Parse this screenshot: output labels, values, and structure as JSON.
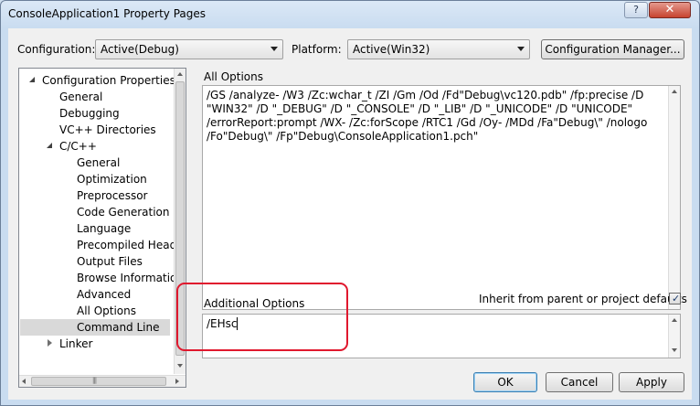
{
  "window": {
    "title": "ConsoleApplication1 Property Pages",
    "help": "?",
    "close": "✕"
  },
  "toolbar": {
    "configuration_label": "Configuration:",
    "configuration_value": "Active(Debug)",
    "platform_label": "Platform:",
    "platform_value": "Active(Win32)",
    "config_manager": "Configuration Manager..."
  },
  "tree": {
    "items": [
      {
        "label": "Configuration Properties"
      },
      {
        "label": "General"
      },
      {
        "label": "Debugging"
      },
      {
        "label": "VC++ Directories"
      },
      {
        "label": "C/C++"
      },
      {
        "label": "General"
      },
      {
        "label": "Optimization"
      },
      {
        "label": "Preprocessor"
      },
      {
        "label": "Code Generation"
      },
      {
        "label": "Language"
      },
      {
        "label": "Precompiled Heade"
      },
      {
        "label": "Output Files"
      },
      {
        "label": "Browse Information"
      },
      {
        "label": "Advanced"
      },
      {
        "label": "All Options"
      },
      {
        "label": "Command Line",
        "selected": true
      },
      {
        "label": "Linker"
      }
    ]
  },
  "all_options": {
    "label": "All Options",
    "text": "/GS /analyze- /W3 /Zc:wchar_t /ZI /Gm /Od /Fd\"Debug\\vc120.pdb\" /fp:precise /D \"WIN32\" /D \"_DEBUG\" /D \"_CONSOLE\" /D \"_LIB\" /D \"_UNICODE\" /D \"UNICODE\" /errorReport:prompt /WX- /Zc:forScope /RTC1 /Gd /Oy- /MDd /Fa\"Debug\\\" /nologo /Fo\"Debug\\\" /Fp\"Debug\\ConsoleApplication1.pch\""
  },
  "additional_options": {
    "label": "Additional Options",
    "value": "/EHsc",
    "inherit_label": "Inherit from parent or project defaults",
    "inherit_checked": true
  },
  "buttons": {
    "ok": "OK",
    "cancel": "Cancel",
    "apply": "Apply"
  },
  "colors": {
    "highlight": "#e0182e",
    "selection": "#d9d9d9",
    "close_button": "#c7432f"
  }
}
